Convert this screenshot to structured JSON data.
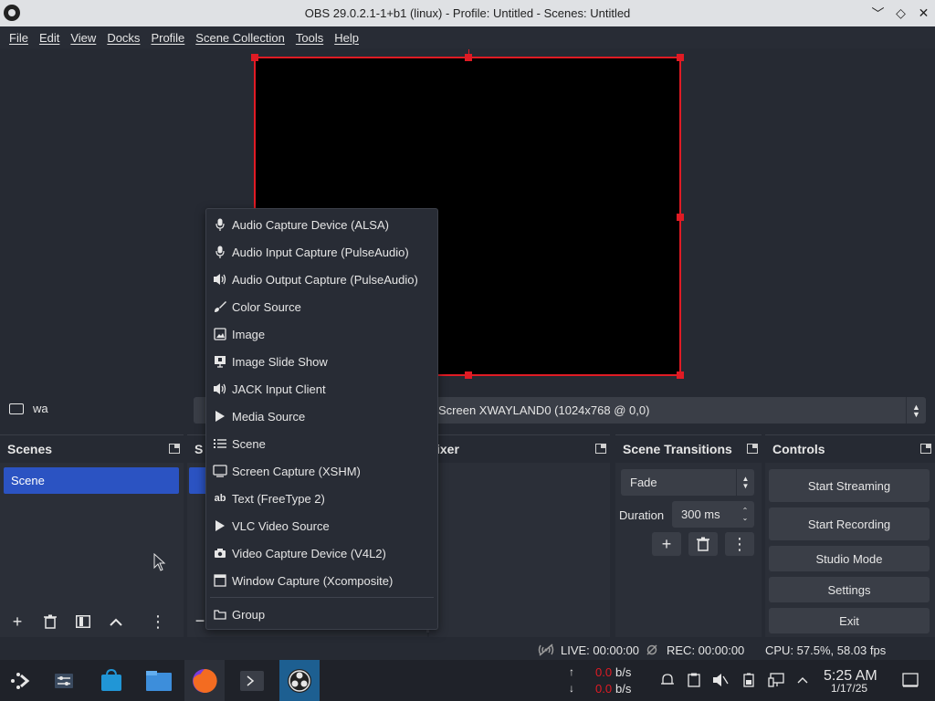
{
  "window": {
    "title": "OBS 29.0.2.1-1+b1 (linux) - Profile: Untitled - Scenes: Untitled",
    "minimize": "﹀",
    "maximize": "◇",
    "close": "✕"
  },
  "menu": [
    "File",
    "Edit",
    "View",
    "Docks",
    "Profile",
    "Scene Collection",
    "Tools",
    "Help"
  ],
  "source_bar": {
    "source_name": "wa",
    "display_value": "Screen XWAYLAND0 (1024x768 @ 0,0)"
  },
  "scenes": {
    "title": "Scenes",
    "items": [
      "Scene"
    ]
  },
  "sources": {
    "title_fragment": "S"
  },
  "mixer": {
    "title_fragment": "ixer"
  },
  "transitions": {
    "title": "Scene Transitions",
    "transition": "Fade",
    "duration_label": "Duration",
    "duration_value": "300 ms"
  },
  "controls": {
    "title": "Controls",
    "start_streaming": "Start Streaming",
    "start_recording": "Start Recording",
    "studio_mode": "Studio Mode",
    "settings": "Settings",
    "exit": "Exit"
  },
  "status": {
    "live": "LIVE: 00:00:00",
    "rec": "REC: 00:00:00",
    "cpu": "CPU: 57.5%, 58.03 fps"
  },
  "taskbar": {
    "up_rate": "0.0",
    "down_rate": "0.0",
    "rate_unit": "b/s",
    "time": "5:25 AM",
    "date": "1/17/25"
  },
  "context_menu": {
    "items": [
      {
        "label": "Audio Capture Device (ALSA)",
        "icon": "microphone-icon"
      },
      {
        "label": "Audio Input Capture (PulseAudio)",
        "icon": "microphone-icon"
      },
      {
        "label": "Audio Output Capture (PulseAudio)",
        "icon": "speaker-icon"
      },
      {
        "label": "Color Source",
        "icon": "brush-icon"
      },
      {
        "label": "Image",
        "icon": "image-icon"
      },
      {
        "label": "Image Slide Show",
        "icon": "slideshow-icon"
      },
      {
        "label": "JACK Input Client",
        "icon": "speaker-icon"
      },
      {
        "label": "Media Source",
        "icon": "play-icon"
      },
      {
        "label": "Scene",
        "icon": "list-icon"
      },
      {
        "label": "Screen Capture (XSHM)",
        "icon": "monitor-icon"
      },
      {
        "label": "Text (FreeType 2)",
        "icon": "text-icon"
      },
      {
        "label": "VLC Video Source",
        "icon": "play-icon"
      },
      {
        "label": "Video Capture Device (V4L2)",
        "icon": "camera-icon"
      },
      {
        "label": "Window Capture (Xcomposite)",
        "icon": "window-icon"
      },
      {
        "label": "Group",
        "icon": "folder-icon"
      }
    ]
  },
  "colors": {
    "accent": "#2b53c2",
    "selection_border": "#e01b24",
    "recording_red": "#e01b24"
  }
}
